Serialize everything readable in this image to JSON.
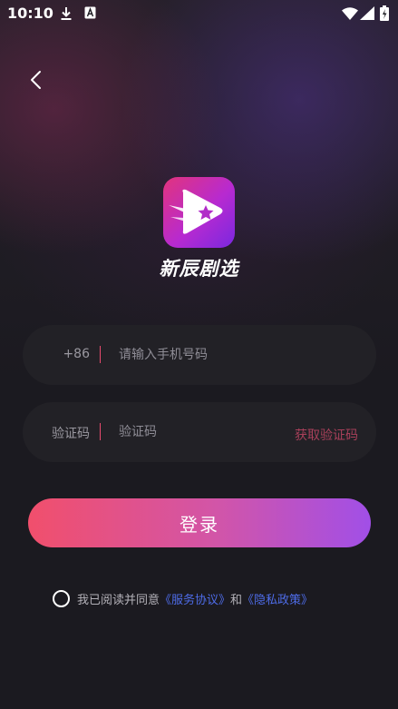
{
  "status_bar": {
    "time": "10:10",
    "icons": [
      "download-icon",
      "a-notification-icon",
      "wifi-icon",
      "signal-icon",
      "battery-icon"
    ]
  },
  "header": {
    "back_icon": "chevron-left-icon"
  },
  "app": {
    "name": "新辰剧选"
  },
  "phone": {
    "country_code": "+86",
    "placeholder": "请输入手机号码",
    "value": ""
  },
  "code": {
    "label": "验证码",
    "placeholder": "验证码",
    "value": "",
    "get_code_label": "获取验证码"
  },
  "login": {
    "label": "登录"
  },
  "agreement": {
    "prefix": "我已阅读并同意",
    "service_link": "《服务协议》",
    "and": "和",
    "privacy_link": "《隐私政策》",
    "checked": false
  },
  "colors": {
    "accent_gradient_start": "#f14f6c",
    "accent_gradient_end": "#a14fe7",
    "link": "#4e6ce8",
    "get_code": "#a8405a",
    "background": "#1b1a20"
  }
}
